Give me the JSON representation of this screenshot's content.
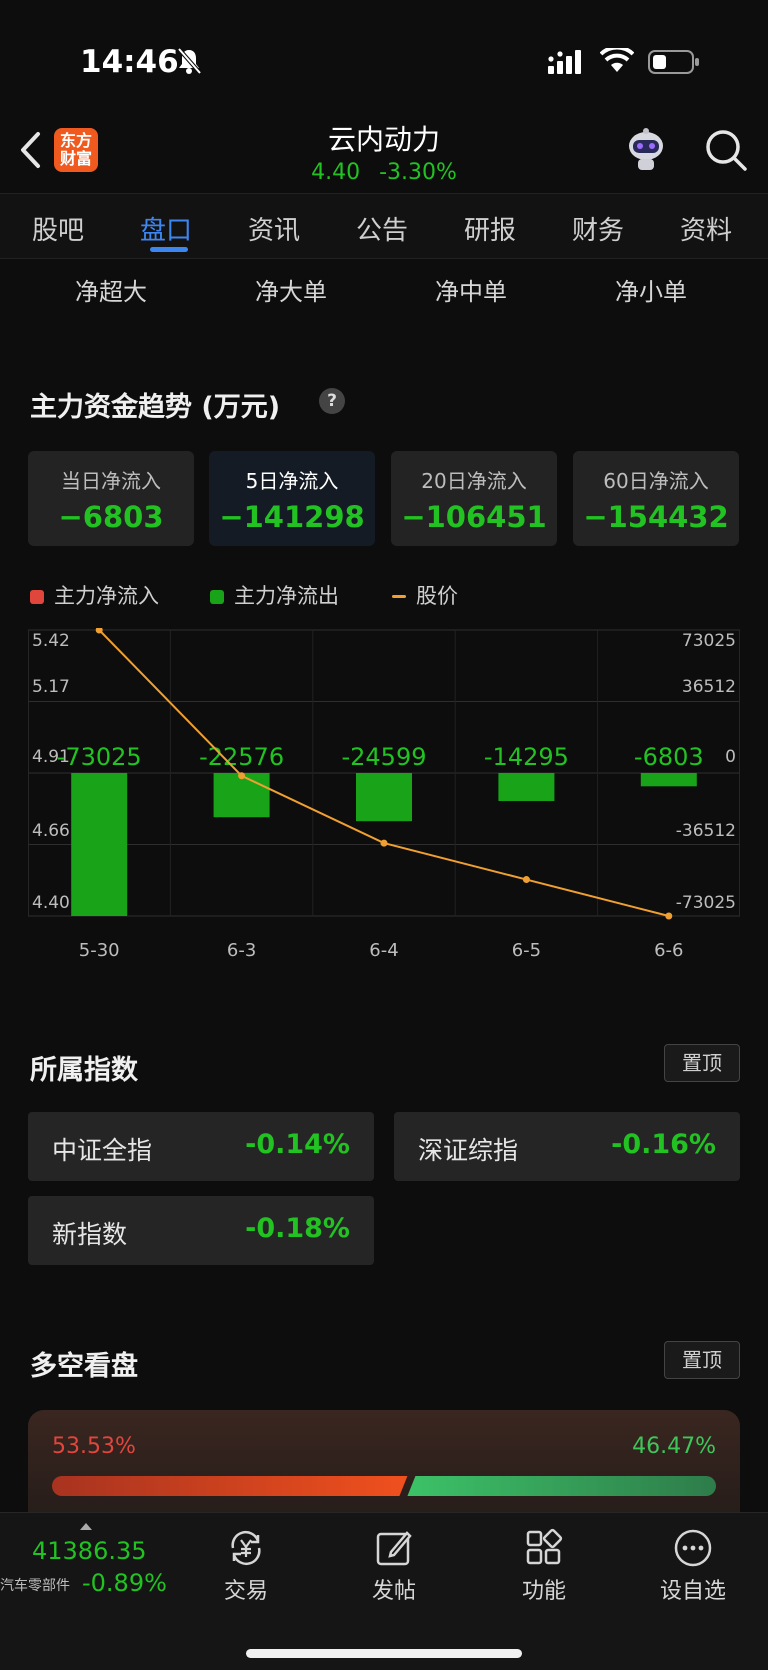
{
  "status_bar": {
    "time": "14:46"
  },
  "header": {
    "logo_line1": "东方",
    "logo_line2": "财富",
    "stock_name": "云内动力",
    "price": "4.40",
    "change_pct": "-3.30%"
  },
  "tabs": [
    "股吧",
    "盘口",
    "资讯",
    "公告",
    "研报",
    "财务",
    "资料"
  ],
  "active_tab": "盘口",
  "subtabs": [
    "净超大",
    "净大单",
    "净中单",
    "净小单"
  ],
  "flow": {
    "title": "主力资金趋势 (万元)",
    "help": "?",
    "cards": [
      {
        "label": "当日净流入",
        "value": "−6803"
      },
      {
        "label": "5日净流入",
        "value": "−141298"
      },
      {
        "label": "20日净流入",
        "value": "−106451"
      },
      {
        "label": "60日净流入",
        "value": "−154432"
      }
    ],
    "legend": {
      "inflow": "主力净流入",
      "outflow": "主力净流出",
      "price": "股价"
    }
  },
  "chart_data": {
    "type": "bar",
    "categories": [
      "5-30",
      "6-3",
      "6-4",
      "6-5",
      "6-6"
    ],
    "series": [
      {
        "name": "主力净流出",
        "values": [
          -73025,
          -22576,
          -24599,
          -14295,
          -6803
        ],
        "color": "#19a319"
      },
      {
        "name": "股价",
        "values": [
          5.42,
          4.9,
          4.66,
          4.53,
          4.4
        ],
        "color": "#f0a030",
        "type": "line"
      }
    ],
    "data_labels": [
      "-73025",
      "-22576",
      "-24599",
      "-14295",
      "-6803"
    ],
    "left_ticks": [
      "5.42",
      "5.17",
      "4.91",
      "4.66",
      "4.40"
    ],
    "right_ticks": [
      "73025",
      "36512",
      "0",
      "-36512",
      "-73025"
    ],
    "ylim_left": [
      4.4,
      5.42
    ],
    "ylim_right": [
      -73025,
      73025
    ],
    "grid": true
  },
  "index": {
    "title": "所属指数",
    "pin_label": "置顶",
    "items": [
      {
        "name": "中证全指",
        "pct": "-0.14%"
      },
      {
        "name": "深证综指",
        "pct": "-0.16%"
      },
      {
        "name": "新指数",
        "pct": "-0.18%"
      }
    ]
  },
  "bullbear": {
    "title": "多空看盘",
    "pin_label": "置顶",
    "bull_pct": "53.53%",
    "bear_pct": "46.47%",
    "bull_fraction": 0.5353
  },
  "bottom_nav": {
    "market_value": "41386.35",
    "market_name": "汽车零部件",
    "market_pct": "-0.89%",
    "items": [
      "交易",
      "发帖",
      "功能",
      "设自选"
    ]
  },
  "colors": {
    "green": "#22c222",
    "red": "#e0463c",
    "blue": "#3d86f0",
    "orange": "#f0a030"
  }
}
